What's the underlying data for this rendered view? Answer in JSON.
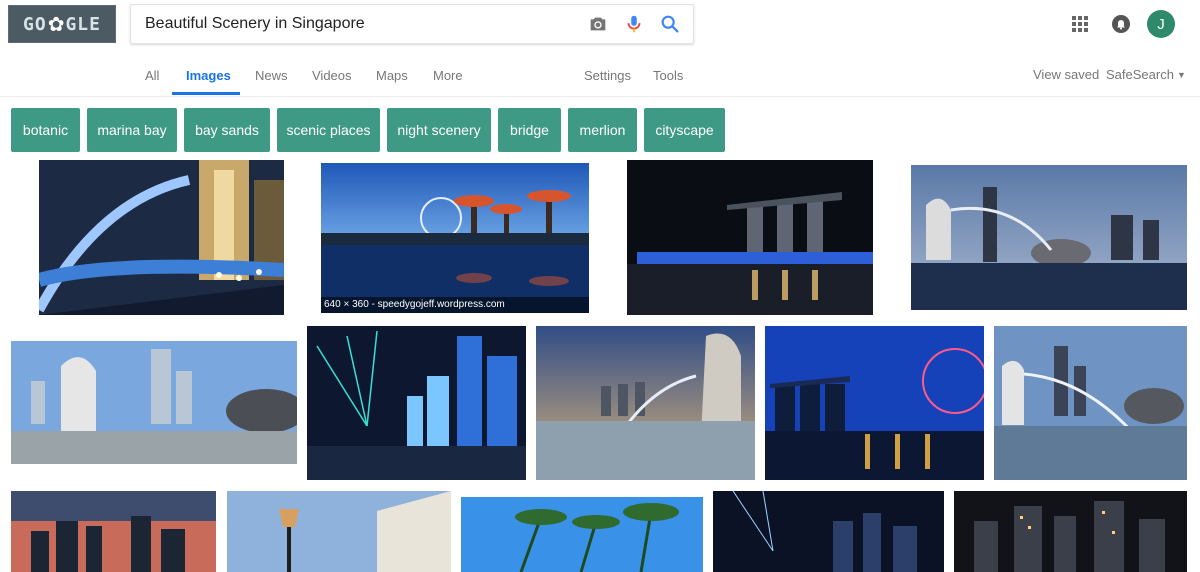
{
  "search": {
    "query": "Beautiful Scenery in Singapore"
  },
  "nav": {
    "tabs": [
      {
        "label": "All"
      },
      {
        "label": "Images"
      },
      {
        "label": "News"
      },
      {
        "label": "Videos"
      },
      {
        "label": "Maps"
      },
      {
        "label": "More"
      },
      {
        "label": "Settings"
      },
      {
        "label": "Tools"
      }
    ],
    "active_tab": "Images",
    "view_saved": "View saved",
    "safesearch": "SafeSearch"
  },
  "user": {
    "avatar_letter": "J",
    "avatar_color": "#2f8a6b"
  },
  "chips": [
    "botanic",
    "marina bay",
    "bay sands",
    "scenic places",
    "night scenery",
    "bridge",
    "merlion",
    "cityscape"
  ],
  "colors": {
    "chip": "#3f9a85",
    "accent": "#1a73e8",
    "mic_blue": "#4285f4",
    "mic_red": "#ea4335"
  },
  "images": {
    "hover_caption": "640 × 360 - speedygojeff.wordpress.com"
  }
}
